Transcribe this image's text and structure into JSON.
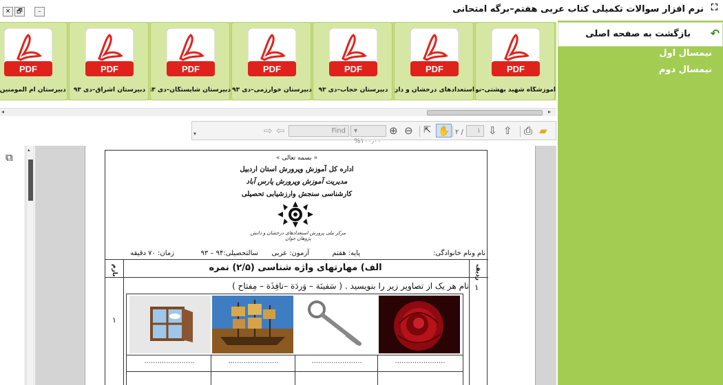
{
  "window": {
    "title": "نرم افزار سوالات تکمیلی کتاب عربی هفتم–برگه امتحانی",
    "app_icon_glyph": "⛶",
    "controls": {
      "minimize": "–",
      "restore": "🗗",
      "close": "✕"
    }
  },
  "sidebar": {
    "back_label": "بازگشت به صفحه اصلی",
    "items": [
      {
        "label": "نیمسال اول"
      },
      {
        "label": "نیمسال دوم"
      }
    ],
    "bg_color": "#a3cc52"
  },
  "pdf_strip": {
    "badge_text": "PDF",
    "items": [
      {
        "caption": "آموزشگاه شهید بهشتی–نوه..."
      },
      {
        "caption": "استعدادهای درخشان و دان..."
      },
      {
        "caption": "دبیرستان حجاب–دی ۹۳"
      },
      {
        "caption": "دبیرستان خوارزمی–دی ۹۳"
      },
      {
        "caption": "دبیرستان شایستگان–دی ۹۳"
      },
      {
        "caption": "دبیرستان اشراق–دی ۹۳"
      },
      {
        "caption": "دبیرستان ام المومنین–نو"
      }
    ]
  },
  "toolbar": {
    "page_current": "۱",
    "page_total": "۲ /",
    "zoom": "%۱۰۰٫۰۰",
    "find_placeholder": "Find",
    "icons": [
      "folder-icon",
      "print-icon",
      "up-arrow-icon",
      "down-arrow-icon",
      "hand-tool-icon",
      "select-tool-icon",
      "zoom-out-icon",
      "zoom-in-icon",
      "prev-result-icon",
      "next-result-icon"
    ]
  },
  "document": {
    "bismillah": "« بسمه تعالی »",
    "org_line1": "اداره کل آموزش وپرورش استان اردبیل",
    "org_line2": "مدیریت آموزش وپرورش پارس آباد",
    "org_line3": "کارشناسی سنجش وارزشیابی تحصیلی",
    "logo_caption": "مرکز ملی پرورش استعدادهای درخشان و دانش پژوهان جوان",
    "info": {
      "name": "نام ونام خانوادگی:",
      "grade": "پایه: هفتم",
      "exam": "آزمون: عربی",
      "year": "سالتحصیلی:۹۴ – ۹۳",
      "time": "زمان: ۷۰ دقیقه"
    },
    "section_title": "الف) مهارتهای واژه شناسی (۲/۵) نمره",
    "col_row_label": "ردیف",
    "col_score_label": "بارم",
    "question_number": "۱",
    "question_text": "نام هر یک از تصاویر زیر را بنویسید . ( سَفینَة – وَردَة –نافِذَة – مِفتاح )",
    "question_score": "۱",
    "answer_blank": "......................."
  }
}
